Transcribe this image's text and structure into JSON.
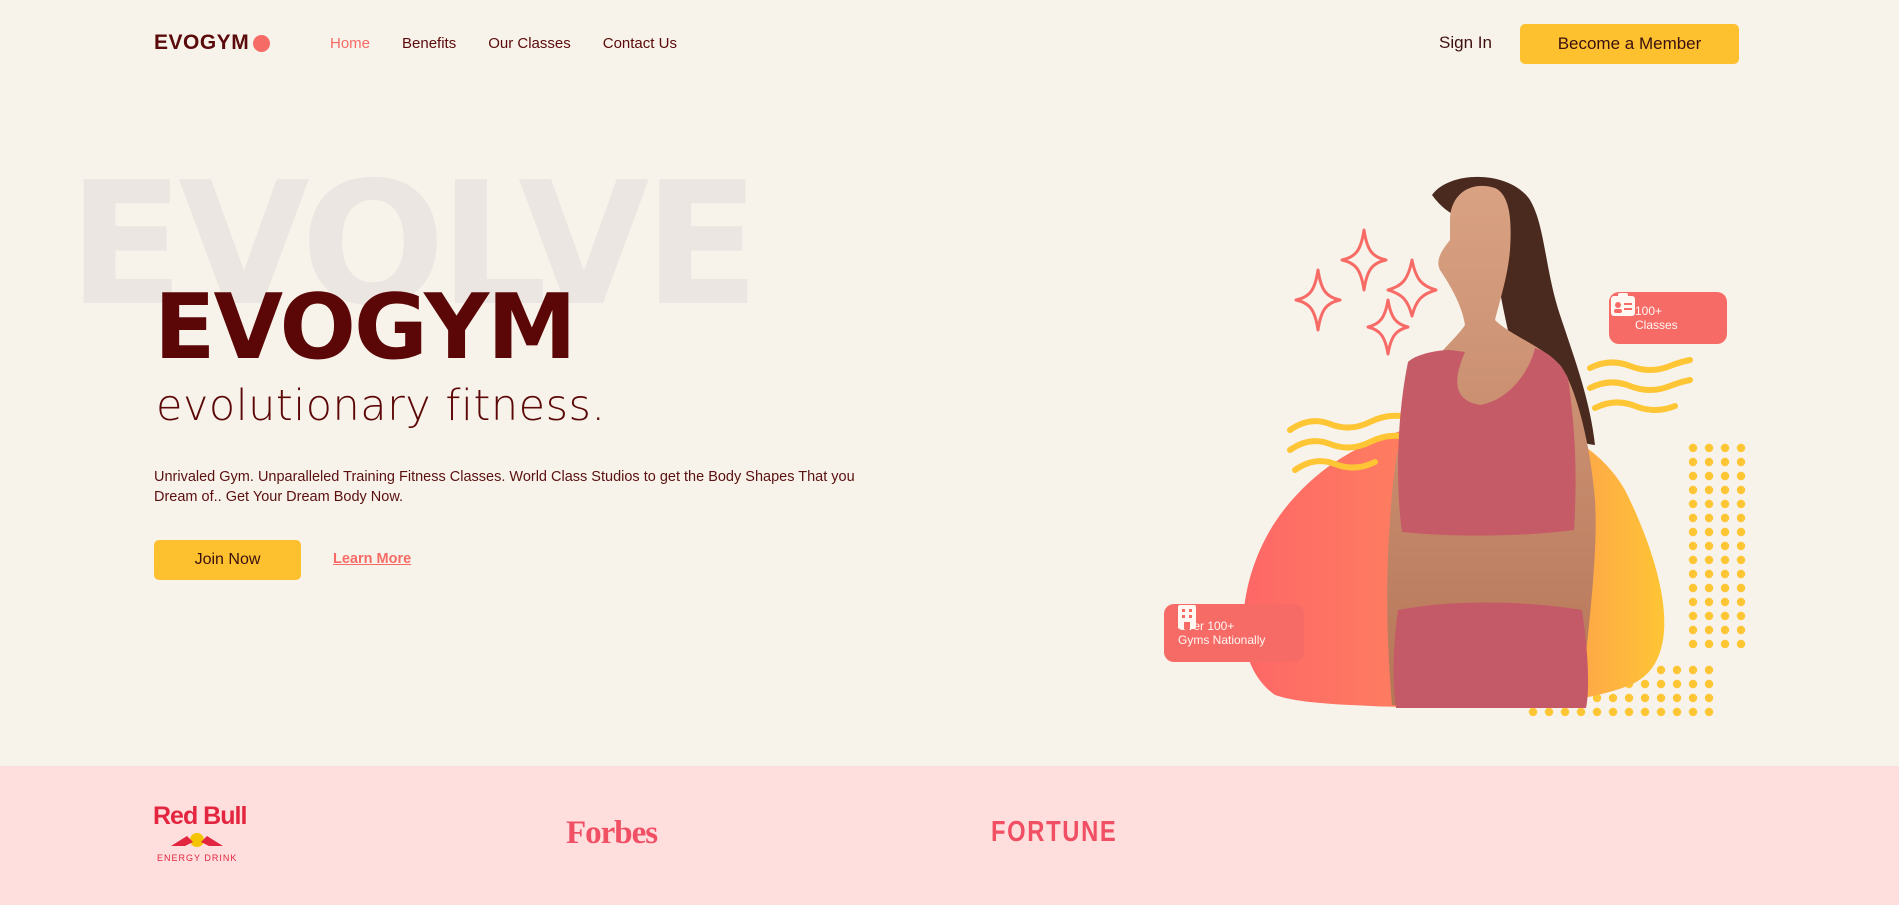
{
  "nav": {
    "logo": "EVOGYM",
    "links": [
      {
        "label": "Home",
        "active": true
      },
      {
        "label": "Benefits",
        "active": false
      },
      {
        "label": "Our Classes",
        "active": false
      },
      {
        "label": "Contact Us",
        "active": false
      }
    ],
    "sign_in": "Sign In",
    "member_button": "Become a Member"
  },
  "hero": {
    "background_word": "EVOLVE",
    "title": "EVOGYM",
    "subtitle": "evolutionary fitness.",
    "description": "Unrivaled Gym. Unparalleled Training Fitness Classes. World Class Studios to get the Body Shapes That you Dream of.. Get Your Dream Body Now.",
    "join_button": "Join Now",
    "learn_more": "Learn More"
  },
  "badges": {
    "classes_line1": "100+",
    "classes_line2": "Classes",
    "gyms_line1": "Over 100+",
    "gyms_line2": "Gyms Nationally"
  },
  "sponsors": {
    "redbull_name": "Red Bull",
    "redbull_sub": "ENERGY DRINK",
    "forbes": "Forbes",
    "fortune": "FORTUNE"
  },
  "colors": {
    "background": "#f8f3ea",
    "primary_dark": "#5c0707",
    "accent_coral": "#f76b67",
    "accent_yellow": "#fdc12f",
    "sponsor_band": "#ffdfde"
  },
  "icons": [
    "id-card-icon",
    "building-icon",
    "sparkle-icon"
  ]
}
